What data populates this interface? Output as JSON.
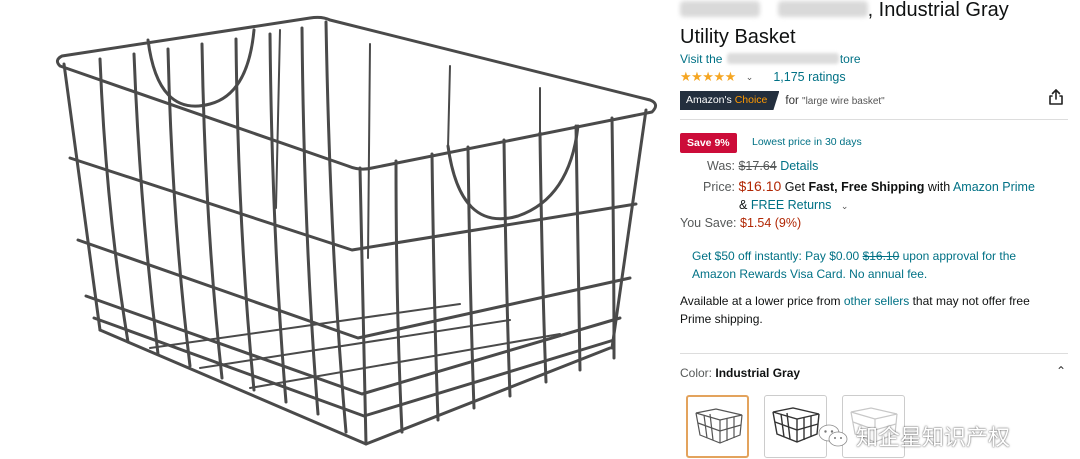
{
  "product": {
    "title_line1_suffix": ", Industrial Gray",
    "title_line2": "Utility Basket",
    "store_prefix": "Visit the",
    "store_suffix": "tore",
    "stars": "★★★★★",
    "ratings_count": "1,175 ratings",
    "choice_badge_prefix": "Amazon's",
    "choice_badge_accent": "Choice",
    "choice_for_label": "for",
    "choice_for_term": "\"large wire basket\""
  },
  "pricing": {
    "save_badge": "Save 9%",
    "lowest_price_note": "Lowest price in 30 days",
    "was_label": "Was:",
    "was_price": "$17.64",
    "details_link": "Details",
    "price_label": "Price:",
    "price_value": "$16.10",
    "shipping_prefix": "Get",
    "shipping_bold": "Fast, Free Shipping",
    "shipping_with": "with",
    "prime_link": "Amazon Prime",
    "returns_amp": "&",
    "returns_link": "FREE Returns",
    "you_save_label": "You Save:",
    "you_save_value": "$1.54 (9%)"
  },
  "offer": {
    "line1_prefix": "Get $50 off instantly: Pay $0.00",
    "line1_strike": "$16.10",
    "line1_suffix": "upon approval for the",
    "line2": "Amazon Rewards Visa Card. No annual fee."
  },
  "other_sellers": {
    "line1_prefix": "Available at a lower price from",
    "line1_link": "other sellers",
    "line1_suffix": "that may not offer free",
    "line2": "Prime shipping."
  },
  "color": {
    "label": "Color:",
    "selected": "Industrial Gray"
  },
  "watermark": {
    "text": "知企星知识产权"
  },
  "colors": {
    "link": "#007185",
    "price_red": "#b12704",
    "save_badge_bg": "#cc0c39",
    "choice_badge_bg": "#232f3e",
    "choice_accent": "#ff9900",
    "star": "#f5a623",
    "swatch_selected_border": "#e3a35d"
  },
  "icons": {
    "share": "share-icon",
    "chevron_down": "chevron-down-icon",
    "chevron_up": "chevron-up-icon",
    "watermark_logo": "wechat-logo-icon"
  }
}
